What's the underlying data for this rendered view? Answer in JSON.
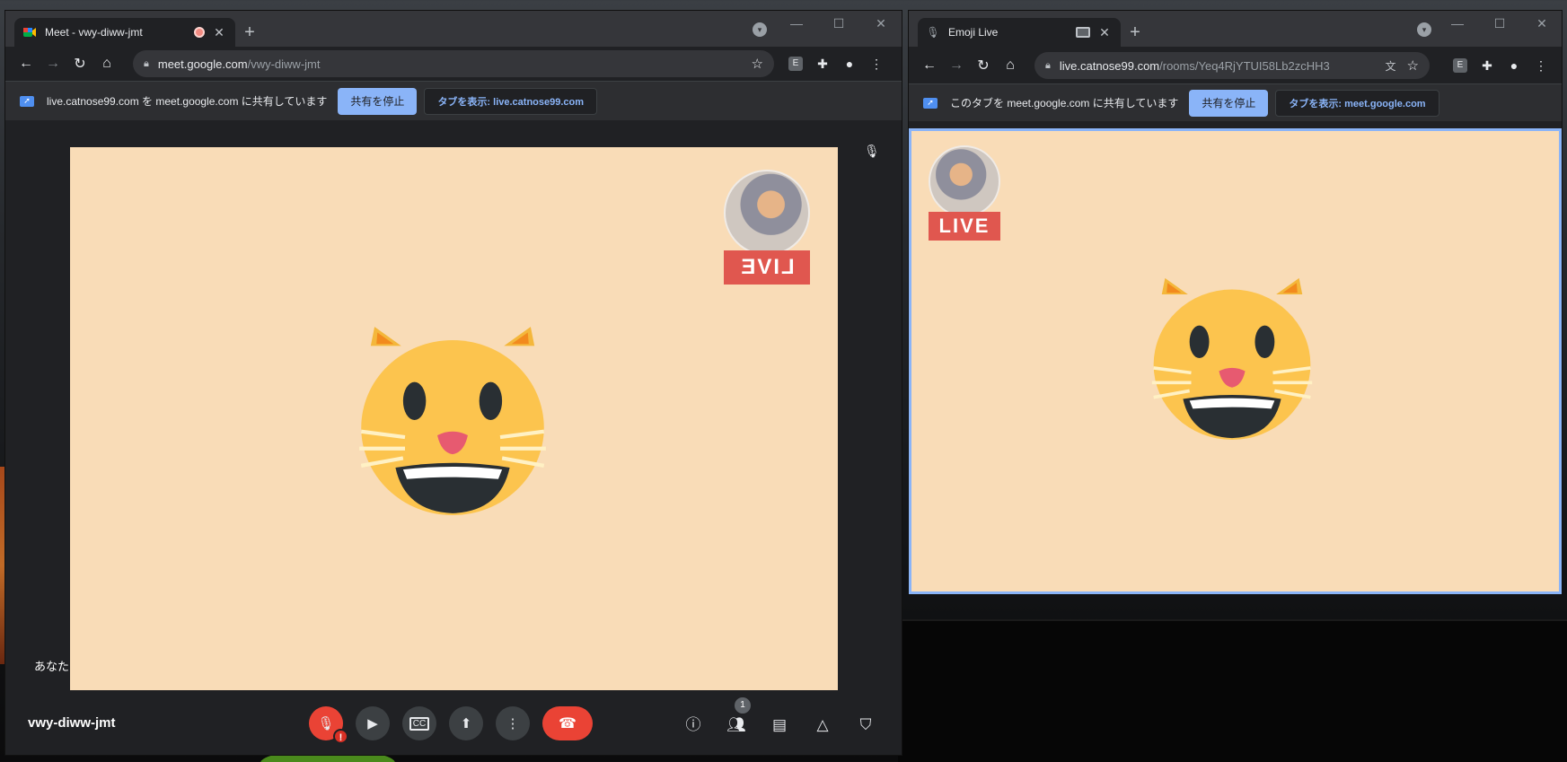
{
  "colors": {
    "stage_bg": "#f9dcb7",
    "accent": "#8ab4f8",
    "danger": "#ea4335",
    "live": "#e0574f"
  },
  "meet_window": {
    "tab": {
      "title": "Meet - vwy-diww-jmt",
      "favicon": "meet-icon",
      "recording_indicator": "recording-dot-icon"
    },
    "url": {
      "host": "meet.google.com",
      "path": "/vwy-diww-jmt"
    },
    "share_bar": {
      "message": "live.catnose99.com を meet.google.com に共有しています",
      "stop_label": "共有を停止",
      "show_tab_label": "タブを表示: live.catnose99.com"
    },
    "self_label": "あなた",
    "live_badge": "LIVE",
    "meeting_code": "vwy-diww-jmt",
    "participants_count": "1",
    "controls": [
      "mic-off-icon",
      "camera-icon",
      "captions-icon",
      "present-icon",
      "more-icon",
      "hangup-icon"
    ],
    "right_controls": [
      "info-icon",
      "people-icon",
      "chat-icon",
      "activities-icon",
      "host-controls-icon"
    ]
  },
  "emoji_window": {
    "tab": {
      "title": "Emoji Live",
      "favicon": "mic-icon",
      "sharing_indicator": "screen-share-icon"
    },
    "url": {
      "host": "live.catnose99.com",
      "path": "/rooms/Yeq4RjYTUI58Lb2zcHH3"
    },
    "share_bar": {
      "message": "このタブを meet.google.com に共有しています",
      "stop_label": "共有を停止",
      "show_tab_label": "タブを表示: meet.google.com"
    },
    "live_badge": "LIVE"
  }
}
